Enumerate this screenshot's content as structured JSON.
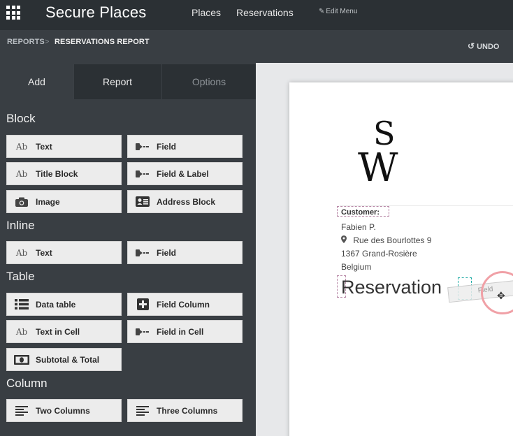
{
  "header": {
    "app_title": "Secure Places",
    "menu": [
      "Places",
      "Reservations"
    ],
    "edit_menu": "Edit Menu"
  },
  "breadcrumb": {
    "items": [
      "REPORTS",
      "RESERVATIONS REPORT"
    ],
    "separator": ">",
    "undo_label": "UNDO"
  },
  "tabs": [
    "Add",
    "Report",
    "Options"
  ],
  "sections": {
    "block": {
      "title": "Block",
      "items": [
        {
          "label": "Text",
          "icon": "text-ab-icon"
        },
        {
          "label": "Field",
          "icon": "field-icon"
        },
        {
          "label": "Title Block",
          "icon": "text-ab-icon"
        },
        {
          "label": "Field & Label",
          "icon": "field-icon"
        },
        {
          "label": "Image",
          "icon": "camera-icon"
        },
        {
          "label": "Address Block",
          "icon": "address-card-icon"
        }
      ]
    },
    "inline": {
      "title": "Inline",
      "items": [
        {
          "label": "Text",
          "icon": "text-ab-icon"
        },
        {
          "label": "Field",
          "icon": "field-icon"
        }
      ]
    },
    "table": {
      "title": "Table",
      "items": [
        {
          "label": "Data table",
          "icon": "list-icon"
        },
        {
          "label": "Field Column",
          "icon": "plus-square-icon"
        },
        {
          "label": "Text in Cell",
          "icon": "text-ab-icon"
        },
        {
          "label": "Field in Cell",
          "icon": "field-icon"
        },
        {
          "label": "Subtotal & Total",
          "icon": "money-icon"
        }
      ]
    },
    "column": {
      "title": "Column",
      "items": [
        {
          "label": "Two Columns",
          "icon": "align-left-icon"
        },
        {
          "label": "Three Columns",
          "icon": "align-left-icon"
        }
      ]
    }
  },
  "report": {
    "logo_letters": [
      "S",
      "W"
    ],
    "customer_label": "Customer:",
    "customer_name": "Fabien P.",
    "street": "Rue des Bourlottes 9",
    "city": "1367 Grand-Rosière",
    "country": "Belgium",
    "title": "Reservation",
    "drag_label": "Field"
  },
  "colors": {
    "topbar": "#2b3034",
    "sidebar": "#393e43",
    "drop_target": "#1aa9a3",
    "drag_ring": "#f0a0a6"
  }
}
